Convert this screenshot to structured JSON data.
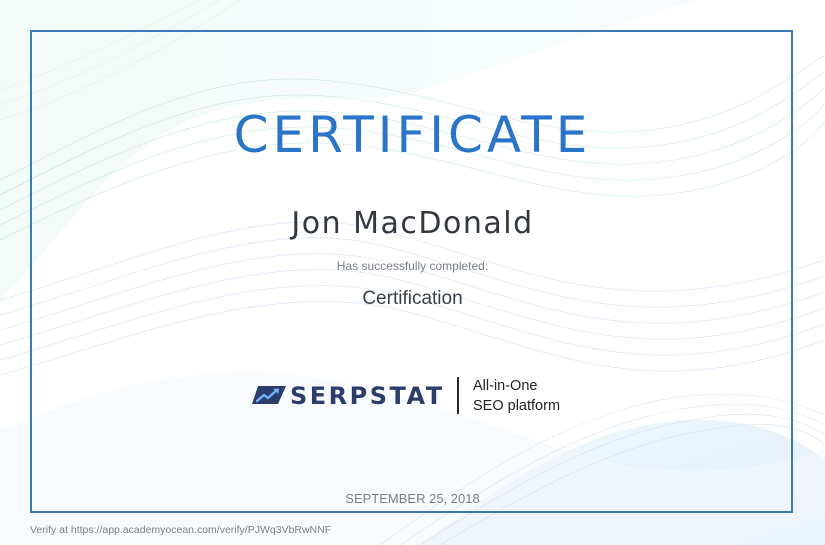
{
  "certificate": {
    "title": "CERTIFICATE",
    "recipient": "Jon MacDonald",
    "completed_label": "Has successfully completed:",
    "course": "Certification",
    "date": "SEPTEMBER 25, 2018"
  },
  "logo": {
    "wordmark": "SERPSTAT",
    "tagline_line1": "All-in-One",
    "tagline_line2": "SEO platform",
    "mark_icon": "serpstat-chart-arrow-icon",
    "color": "#2c3d6b"
  },
  "footer": {
    "verify_prefix": "Verify at ",
    "verify_url": "https://app.academyocean.com/verify/PJWq3VbRwNNF"
  },
  "colors": {
    "frame": "#3b79b9",
    "title": "#2a74c9",
    "text_dark": "#333740",
    "text_muted": "#7a7f87"
  }
}
